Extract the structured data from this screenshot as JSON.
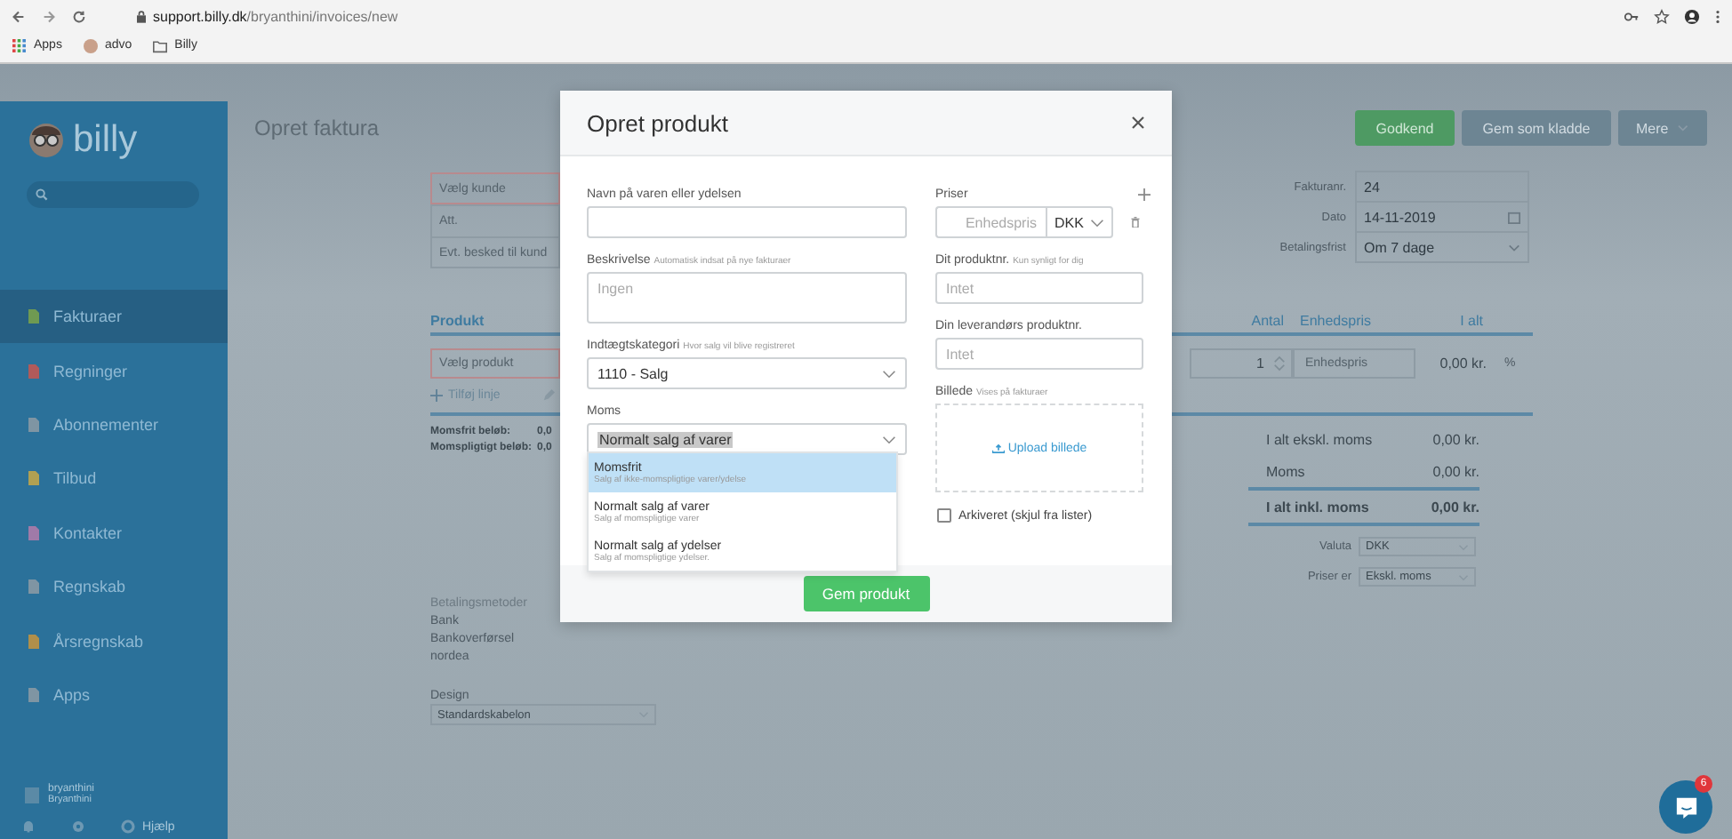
{
  "browser": {
    "url_host": "support.billy.dk",
    "url_path": "/bryanthini/invoices/new",
    "bookmarks": [
      {
        "kind": "apps",
        "label": "Apps"
      },
      {
        "kind": "avatar",
        "label": "advo"
      },
      {
        "kind": "folder",
        "label": "Billy"
      }
    ]
  },
  "sidebar": {
    "logo": "billy",
    "items": [
      {
        "label": "Fakturaer",
        "selected": true,
        "color": "#6f9a52"
      },
      {
        "label": "Regninger",
        "selected": false,
        "color": "#b05a5a"
      },
      {
        "label": "Abonnementer",
        "selected": false,
        "color": "#7f95a3"
      },
      {
        "label": "Tilbud",
        "selected": false,
        "color": "#b0a052"
      },
      {
        "label": "Kontakter",
        "selected": false,
        "color": "#a07aa8"
      },
      {
        "label": "Regnskab",
        "selected": false,
        "color": "#7f95a3"
      },
      {
        "label": "Årsregnskab",
        "selected": false,
        "color": "#b08f4a"
      },
      {
        "label": "Apps",
        "selected": false,
        "color": "#7f95a3"
      }
    ],
    "account": {
      "name": "bryanthini",
      "sub": "Bryanthini"
    },
    "help": "Hjælp"
  },
  "page": {
    "title": "Opret faktura",
    "actions": [
      {
        "kind": "primary",
        "label": "Godkend"
      },
      {
        "kind": "secondary",
        "label": "Gem som kladde"
      },
      {
        "kind": "menu",
        "label": "Mere"
      }
    ],
    "customer_fields": [
      {
        "placeholder": "Vælg kunde",
        "invalid": true
      },
      {
        "placeholder": "Att.",
        "invalid": false
      },
      {
        "placeholder": "Evt. besked til kund",
        "invalid": false
      }
    ],
    "meta_fields": [
      {
        "label": "Fakturanr.",
        "value": "24",
        "kind": "text"
      },
      {
        "label": "Dato",
        "value": "14-11-2019",
        "kind": "date"
      },
      {
        "label": "Betalingsfrist",
        "value": "Om 7 dage",
        "kind": "select"
      }
    ],
    "table": {
      "columns": [
        "Produkt",
        "Antal",
        "Enhedspris",
        "I alt"
      ],
      "row": {
        "product_placeholder": "Vælg produkt",
        "quantity": "1",
        "price_placeholder": "Enhedspris",
        "total": "0,00 kr.",
        "discount": "%"
      },
      "add_line": "Tilføj linje"
    },
    "vat_summary": [
      {
        "label": "Momsfrit beløb:",
        "value": "0,0"
      },
      {
        "label": "Momspligtigt beløb:",
        "value": "0,0"
      }
    ],
    "totals": [
      {
        "label": "I alt ekskl. moms",
        "value": "0,00 kr.",
        "bold": false
      },
      {
        "label": "Moms",
        "value": "0,00 kr.",
        "bold": false
      },
      {
        "label": "I alt inkl. moms",
        "value": "0,00 kr.",
        "bold": true
      }
    ],
    "settings": [
      {
        "label": "Valuta",
        "value": "DKK"
      },
      {
        "label": "Priser er",
        "value": "Ekskl. moms"
      }
    ],
    "payment": {
      "label": "Betalingsmetoder",
      "lines": [
        "Bank",
        "Bankoverførsel",
        "nordea"
      ]
    },
    "design": {
      "label": "Design",
      "value": "Standardskabelon"
    }
  },
  "modal": {
    "title": "Opret produkt",
    "name": {
      "label": "Navn på varen eller ydelsen"
    },
    "description": {
      "label": "Beskrivelse",
      "hint": "Automatisk indsat på nye fakturaer",
      "placeholder": "Ingen"
    },
    "category": {
      "label": "Indtægtskategori",
      "hint": "Hvor salg vil blive registreret",
      "value": "1110 - Salg"
    },
    "vat": {
      "label": "Moms",
      "value": "Normalt salg af varer",
      "expanded": true,
      "options": [
        {
          "title": "Momsfrit",
          "subtitle": "Salg af ikke-momspligtige varer/ydelse",
          "highlighted": true
        },
        {
          "title": "Normalt salg af varer",
          "subtitle": "Salg af momspligtige varer",
          "highlighted": false
        },
        {
          "title": "Normalt salg af ydelser",
          "subtitle": "Salg af momspligtige ydelser.",
          "highlighted": false
        }
      ]
    },
    "prices": {
      "label": "Priser",
      "price_placeholder": "Enhedspris",
      "currency": "DKK"
    },
    "product_no": {
      "label": "Dit produktnr.",
      "hint": "Kun synligt for dig",
      "placeholder": "Intet"
    },
    "supplier_no": {
      "label": "Din leverandørs produktnr.",
      "placeholder": "Intet"
    },
    "image": {
      "label": "Billede",
      "hint": "Vises på fakturaer",
      "upload": "Upload billede"
    },
    "archived": {
      "label": "Arkiveret (skjul fra lister)",
      "checked": false
    },
    "save": "Gem produkt"
  },
  "chat": {
    "badge": "6"
  }
}
